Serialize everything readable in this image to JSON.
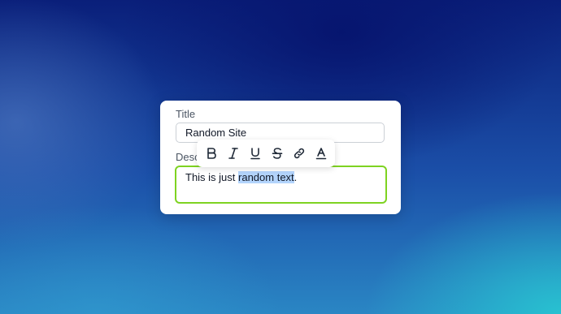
{
  "form": {
    "title_label": "Title",
    "title_value": "Random Site",
    "description_label": "Desc",
    "description_before": "This is just ",
    "description_selected": "random text",
    "description_after": "."
  },
  "toolbar": {
    "buttons": [
      {
        "name": "bold",
        "icon": "bold-icon"
      },
      {
        "name": "italic",
        "icon": "italic-icon"
      },
      {
        "name": "underline",
        "icon": "underline-icon"
      },
      {
        "name": "strikethrough",
        "icon": "strikethrough-icon"
      },
      {
        "name": "link",
        "icon": "link-icon"
      },
      {
        "name": "text-color",
        "icon": "text-color-icon"
      }
    ]
  },
  "colors": {
    "focus_border": "#7ed321",
    "selection": "#b3d4fc"
  }
}
